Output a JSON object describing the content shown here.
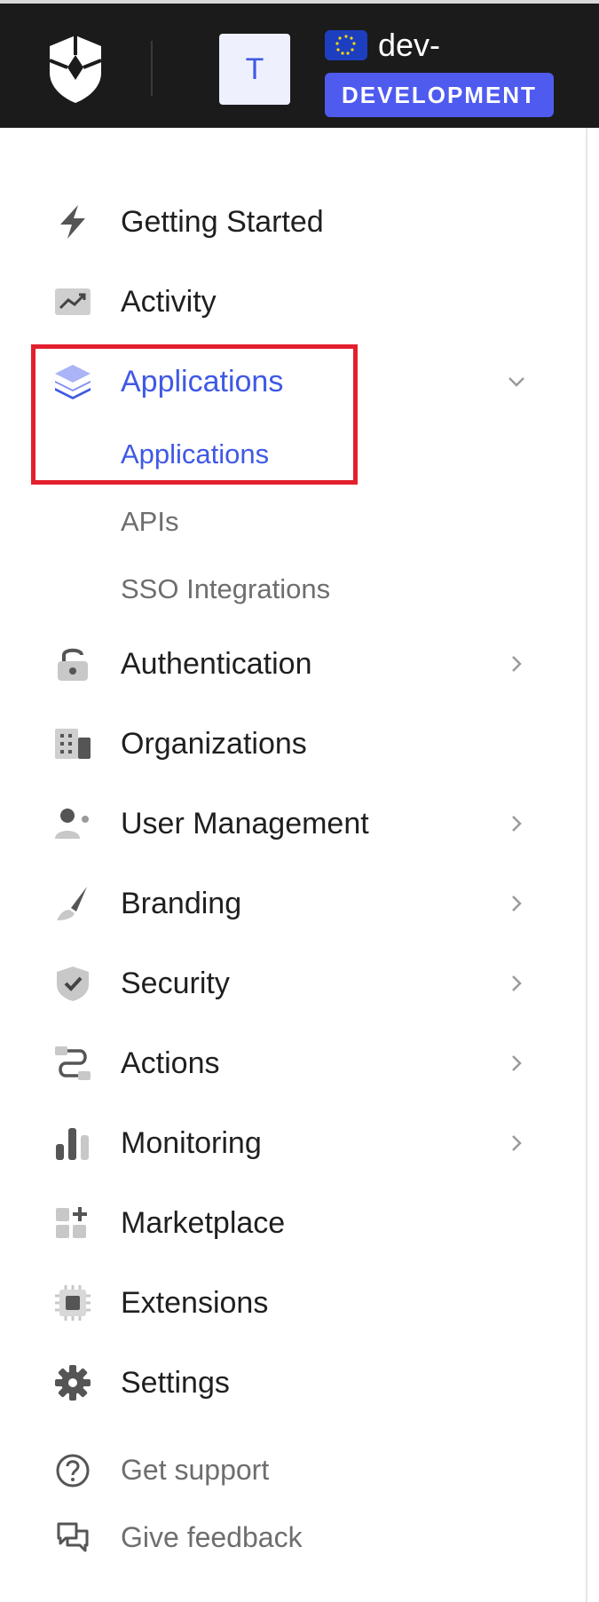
{
  "header": {
    "avatar_letter": "T",
    "tenant_name": "dev-",
    "environment_badge": "DEVELOPMENT",
    "logo_icon": "shield-logo-icon",
    "region_icon": "eu-flag-icon"
  },
  "nav": {
    "getting_started": "Getting Started",
    "activity": "Activity",
    "applications": "Applications",
    "applications_sub": [
      "Applications",
      "APIs",
      "SSO Integrations"
    ],
    "authentication": "Authentication",
    "organizations": "Organizations",
    "user_management": "User Management",
    "branding": "Branding",
    "security": "Security",
    "actions": "Actions",
    "monitoring": "Monitoring",
    "marketplace": "Marketplace",
    "extensions": "Extensions",
    "settings": "Settings"
  },
  "footer": {
    "get_support": "Get support",
    "give_feedback": "Give feedback"
  },
  "colors": {
    "active": "#3f59e4",
    "header_bg": "#1b1b1b",
    "badge": "#4f5bef",
    "highlight": "#e3202d"
  }
}
